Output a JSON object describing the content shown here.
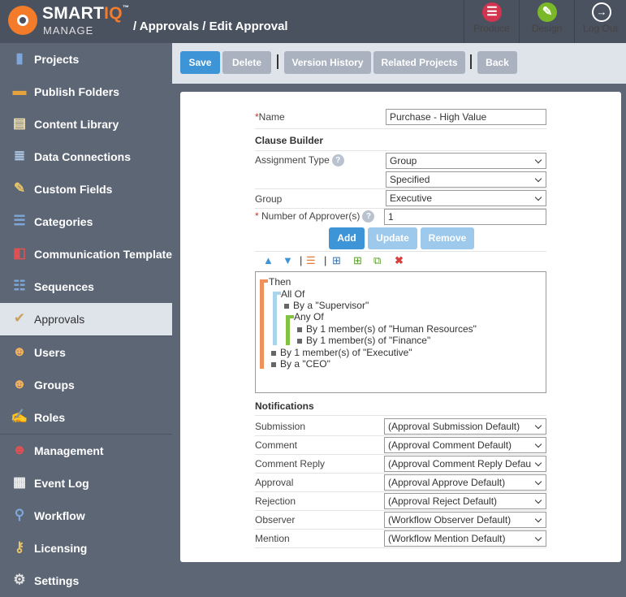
{
  "app": {
    "brand_main": "SMART",
    "brand_iq": "IQ",
    "brand_tm": "™",
    "brand_sub": "MANAGE",
    "breadcrumb": "/ Approvals / Edit Approval"
  },
  "topnav": {
    "produce": "Produce",
    "design": "Design",
    "logout": "Log Out",
    "colors": {
      "produce": "#d0344f",
      "design": "#7ab829",
      "logout": "#4a5260"
    }
  },
  "sidebar": {
    "items": [
      {
        "label": "Projects",
        "icon": "projects-icon"
      },
      {
        "label": "Publish Folders",
        "icon": "folder-icon"
      },
      {
        "label": "Content Library",
        "icon": "library-icon"
      },
      {
        "label": "Data Connections",
        "icon": "database-icon"
      },
      {
        "label": "Custom Fields",
        "icon": "pencil-icon"
      },
      {
        "label": "Categories",
        "icon": "categories-icon"
      },
      {
        "label": "Communication Templates",
        "icon": "megaphone-icon"
      },
      {
        "label": "Sequences",
        "icon": "sequences-icon"
      },
      {
        "label": "Approvals",
        "icon": "approvals-icon",
        "active": true
      },
      {
        "label": "Users",
        "icon": "user-icon"
      },
      {
        "label": "Groups",
        "icon": "groups-icon"
      },
      {
        "label": "Roles",
        "icon": "roles-icon"
      },
      {
        "label": "Management",
        "icon": "management-icon"
      },
      {
        "label": "Event Log",
        "icon": "event-log-icon"
      },
      {
        "label": "Workflow",
        "icon": "workflow-icon"
      },
      {
        "label": "Licensing",
        "icon": "key-icon"
      },
      {
        "label": "Settings",
        "icon": "gear-icon"
      }
    ]
  },
  "toolbar": {
    "save": "Save",
    "delete": "Delete",
    "version_history": "Version History",
    "related_projects": "Related Projects",
    "back": "Back"
  },
  "form": {
    "name_label": "Name",
    "name_value": "Purchase - High Value",
    "clause_builder": "Clause Builder",
    "assignment_type_label": "Assignment Type",
    "assignment_type_value": "Group",
    "specified_value": "Specified",
    "group_label": "Group",
    "group_value": "Executive",
    "num_approvers_label": "Number of Approver(s)",
    "num_approvers_value": "1",
    "add": "Add",
    "update": "Update",
    "remove": "Remove"
  },
  "tree": {
    "then": "Then",
    "all_of": "All Of",
    "supervisor": "By a \"Supervisor\"",
    "any_of": "Any Of",
    "hr": "By 1 member(s) of \"Human Resources\"",
    "finance": "By 1 member(s) of \"Finance\"",
    "executive": "By 1 member(s) of \"Executive\"",
    "ceo": "By a \"CEO\""
  },
  "notifications": {
    "header": "Notifications",
    "rows": [
      {
        "label": "Submission",
        "value": "(Approval Submission Default)"
      },
      {
        "label": "Comment",
        "value": "(Approval Comment Default)"
      },
      {
        "label": "Comment Reply",
        "value": "(Approval Comment Reply Defau"
      },
      {
        "label": "Approval",
        "value": "(Approval Approve Default)"
      },
      {
        "label": "Rejection",
        "value": "(Approval Reject Default)"
      },
      {
        "label": "Observer",
        "value": "(Workflow Observer Default)"
      },
      {
        "label": "Mention",
        "value": "(Workflow Mention Default)"
      }
    ]
  }
}
